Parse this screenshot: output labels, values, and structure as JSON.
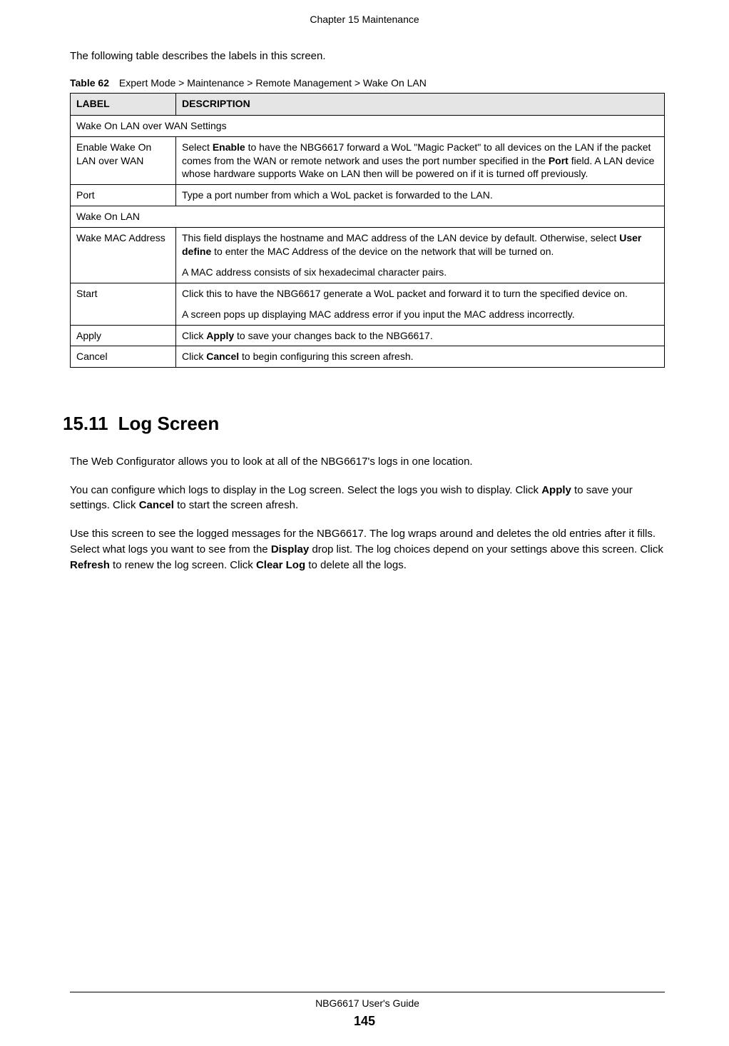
{
  "header": {
    "chapter": "Chapter 15 Maintenance"
  },
  "intro": "The following table describes the labels in this screen.",
  "table": {
    "caption_label": "Table 62",
    "caption_text": "Expert Mode > Maintenance > Remote Management > Wake On LAN",
    "headers": {
      "label": "LABEL",
      "description": "DESCRIPTION"
    },
    "rows": [
      {
        "type": "section",
        "text": "Wake On LAN over WAN Settings"
      },
      {
        "type": "row",
        "label": "Enable Wake On LAN over WAN",
        "desc_html": "Select <b>Enable</b> to have the NBG6617 forward a WoL \"Magic Packet\" to all devices on the LAN if the packet comes from the WAN or remote network and uses the port number specified in the <b>Port</b> field. A LAN device whose hardware supports Wake on LAN then will be powered on if it is turned off previously."
      },
      {
        "type": "row",
        "label": "Port",
        "desc_html": "Type a port number from which a WoL packet is forwarded to the LAN."
      },
      {
        "type": "section",
        "text": "Wake On LAN"
      },
      {
        "type": "row",
        "label": "Wake MAC Address",
        "desc_html": "<p>This field displays the hostname and MAC address of the LAN device by default. Otherwise, select <b>User define</b> to enter the MAC Address of the device on the network that will be turned on.</p><p>A MAC address consists of six hexadecimal character pairs.</p>"
      },
      {
        "type": "row",
        "label": "Start",
        "desc_html": "<p>Click this to have the NBG6617 generate a WoL packet and forward it to turn the specified device on.</p><p>A screen pops up displaying MAC address error if you input the MAC address incorrectly.</p>"
      },
      {
        "type": "row",
        "label": "Apply",
        "desc_html": "Click <b>Apply</b> to save your changes back to the NBG6617."
      },
      {
        "type": "row",
        "label": "Cancel",
        "desc_html": "Click <b>Cancel</b> to begin configuring this screen afresh."
      }
    ]
  },
  "section": {
    "number": "15.11",
    "title": "Log Screen",
    "paragraphs": [
      "The Web Configurator allows you to look at all of the NBG6617's logs in one location.",
      "You can configure which logs to display in the Log screen. Select the logs you wish to display. Click <b>Apply</b> to save your settings. Click <b>Cancel</b> to start the screen afresh.",
      "Use this screen to see the logged messages for the NBG6617. The log wraps around and deletes the old entries after it fills. Select what logs you want to see from the <b>Display</b> drop list. The log choices depend on your settings above this screen. Click <b>Refresh</b> to renew the log screen. Click <b>Clear Log</b> to delete all the logs."
    ]
  },
  "footer": {
    "guide": "NBG6617 User's Guide",
    "page": "145"
  }
}
